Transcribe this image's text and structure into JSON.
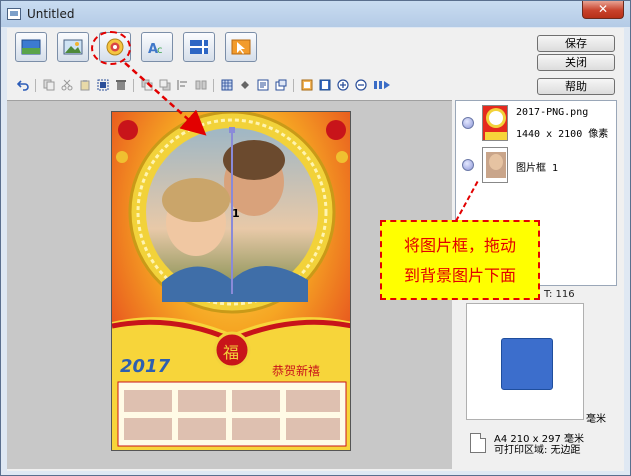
{
  "window": {
    "title": "Untitled",
    "close_label": "✕"
  },
  "side_buttons": {
    "save": "保存",
    "close": "关闭",
    "help": "帮助"
  },
  "layers": [
    {
      "name": "2017-PNG.png",
      "size": "1440 x 2100 像素"
    },
    {
      "name": "图片框  1"
    }
  ],
  "canvas": {
    "frame_label": "1"
  },
  "coord": "T: 116",
  "unit": "毫米",
  "paper": {
    "size": "A4 210 x 297 毫米",
    "print_area": "可打印区域: 无边距"
  },
  "callout": {
    "line1": "将图片框，拖动",
    "line2": "到背景图片下面"
  },
  "poster": {
    "year": "2017",
    "greeting": "恭贺新禧",
    "badge": "福"
  },
  "colors": {
    "accent": "#e20000",
    "callout_bg": "#ffff00",
    "poster_red": "#e52a1e",
    "frame_gold": "#f2d23a"
  }
}
